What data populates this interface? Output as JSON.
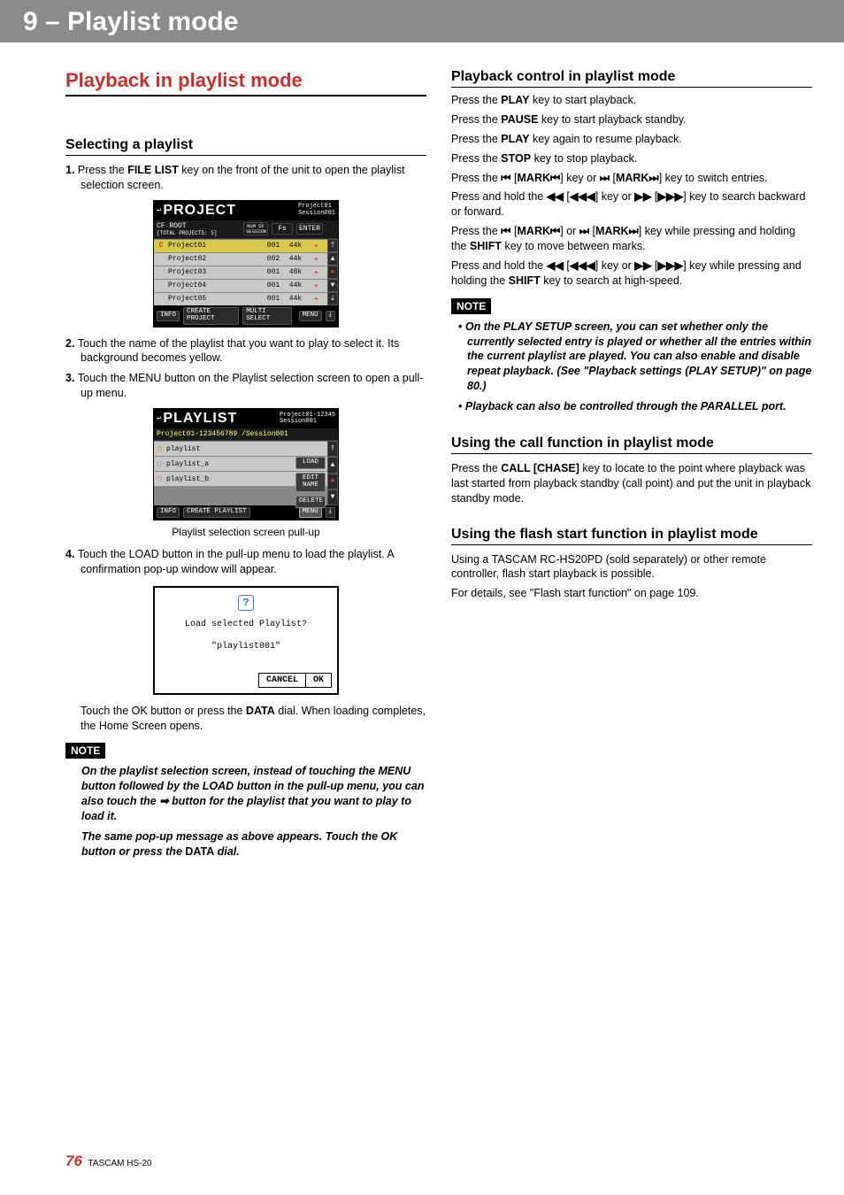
{
  "chapter_title": "9 – Playlist mode",
  "footer": {
    "page": "76",
    "model": "TASCAM HS-20"
  },
  "left": {
    "h1": "Playback in playlist mode",
    "s1": {
      "title": "Selecting a playlist",
      "step1_a": "Press the ",
      "step1_key": "FILE LIST",
      "step1_b": " key on the front of the unit to open the playlist selection screen.",
      "step2": "Touch the name of the playlist that you want to play to select it. Its background becomes yellow.",
      "step3": "Touch the MENU button on the Playlist selection screen to open a pull-up menu.",
      "caption2": "Playlist selection screen pull-up",
      "step4": "Touch the LOAD button in the pull-up menu to load the playlist.  A confirmation pop-up window will appear.",
      "after4_a": "Touch the OK button or press the ",
      "after4_key": "DATA",
      "after4_b": " dial. When loading completes, the Home Screen opens.",
      "note_label": "NOTE",
      "note1": "On the playlist selection screen, instead of touching the MENU button followed by the LOAD button in the pull-up menu, you can also touch the ➡ button for the playlist that you want to play to load it.",
      "note2_a": "The same pop-up message as above appears. Touch the OK button or press the ",
      "note2_key": "DATA",
      "note2_b": " dial."
    }
  },
  "right": {
    "s2": {
      "title": "Playback control in playlist mode",
      "p1_a": "Press the ",
      "p1_key": "PLAY",
      "p1_b": " key to start playback.",
      "p2_a": "Press the ",
      "p2_key": "PAUSE",
      "p2_b": " key to start playback standby.",
      "p3_a": "Press the ",
      "p3_key": "PLAY",
      "p3_b": " key again to resume playback.",
      "p4_a": "Press the ",
      "p4_key": "STOP",
      "p4_b": " key to stop playback.",
      "p5_a": "Press the ",
      "p5_s1": "⏮",
      "p5_m1": "MARK⏮",
      "p5_mid": "] key or ",
      "p5_s2": "⏭",
      "p5_m2": "MARK⏭",
      "p5_b": "] key to switch entries.",
      "p6_a": "Press and hold the ",
      "p6_s1": "◀◀",
      "p6_m1": "◀◀◀",
      "p6_mid": "] key or ",
      "p6_s2": "▶▶",
      "p6_m2": "▶▶▶",
      "p6_b": "] key to search backward or forward.",
      "p7_a": "Press the ",
      "p7_s1": "⏮",
      "p7_m1": "MARK⏮",
      "p7_mid": "] or ",
      "p7_s2": "⏭",
      "p7_m2": "MARK⏭",
      "p7_b": "] key while pressing and holding the ",
      "p7_key": "SHIFT",
      "p7_c": " key to move between marks.",
      "p8_a": "Press and hold the ",
      "p8_s1": "◀◀",
      "p8_m1": "◀◀◀",
      "p8_mid": "] key or ",
      "p8_s2": "▶▶",
      "p8_m2": "▶▶▶",
      "p8_b": "] key while pressing and holding the ",
      "p8_key": "SHIFT",
      "p8_c": " key to search at high-speed.",
      "note_label": "NOTE",
      "note1": "On the PLAY SETUP screen, you can set whether only the currently selected entry is played or whether all the entries within the current playlist are played. You can also enable and disable repeat playback. (See \"Playback settings (PLAY SETUP)\" on page 80.)",
      "note2": "Playback can also be controlled through the PARALLEL port."
    },
    "s3": {
      "title": "Using the call function in playlist mode",
      "p_a": "Press the ",
      "p_key": "CALL [CHASE]",
      "p_b": " key to locate to the point where playback was last started from playback standby (call point) and put the unit in playback standby mode."
    },
    "s4": {
      "title": "Using the flash start function in playlist mode",
      "p1": "Using a TASCAM RC-HS20PD (sold separately) or other remote controller, flash start playback is possible.",
      "p2": "For details, see \"Flash start function\" on page 109."
    }
  },
  "lcd_project": {
    "title": "PROJECT",
    "crumb1": "Project01",
    "crumb2": "Session001",
    "hdr_left": "CF ROOT",
    "hdr_sub": "[TOTAL PROJECTS: 5]",
    "hdr_c1": "NUM OF SESSION",
    "hdr_c2": "Fs",
    "hdr_c3": "ENTER",
    "rows": [
      {
        "name": "Project01",
        "num": "001",
        "fs": "44k",
        "sel": true
      },
      {
        "name": "Project02",
        "num": "002",
        "fs": "44k",
        "sel": false
      },
      {
        "name": "Project03",
        "num": "001",
        "fs": "48k",
        "sel": false
      },
      {
        "name": "Project04",
        "num": "001",
        "fs": "44k",
        "sel": false
      },
      {
        "name": "Project05",
        "num": "001",
        "fs": "44k",
        "sel": false
      }
    ],
    "foot_info": "INFO",
    "foot_create": "CREATE PROJECT",
    "foot_multi": "MULTI SELECT",
    "foot_menu": "MENU"
  },
  "lcd_playlist": {
    "title": "PLAYLIST",
    "crumb1": "Project01-12345",
    "crumb2": "Session001",
    "path": "Project01-123456789 /Session001",
    "pull_load": "LOAD",
    "pull_edit": "EDIT NAME",
    "pull_delete": "DELETE",
    "rows": [
      {
        "name": "playlist"
      },
      {
        "name": "playlist_a"
      },
      {
        "name": "playlist_b"
      }
    ],
    "foot_info": "INFO",
    "foot_create": "CREATE PLAYLIST",
    "foot_menu": "MENU"
  },
  "popup": {
    "msg": "Load selected Playlist?",
    "target": "\"playlist001\"",
    "cancel": "CANCEL",
    "ok": "OK"
  }
}
